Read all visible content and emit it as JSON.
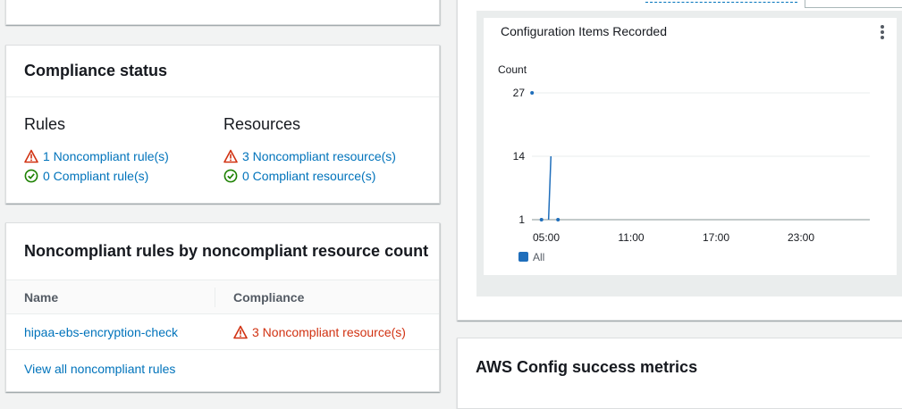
{
  "compliance_status": {
    "title": "Compliance status",
    "rules": {
      "heading": "Rules",
      "noncompliant": "1 Noncompliant rule(s)",
      "compliant": "0 Compliant rule(s)"
    },
    "resources": {
      "heading": "Resources",
      "noncompliant": "3 Noncompliant resource(s)",
      "compliant": "0 Compliant resource(s)"
    }
  },
  "noncompliant_rules": {
    "title": "Noncompliant rules by noncompliant resource count",
    "columns": [
      "Name",
      "Compliance"
    ],
    "rows": [
      {
        "name": "hipaa-ebs-encryption-check",
        "compliance": "3 Noncompliant resource(s)"
      }
    ],
    "view_all": "View all noncompliant rules"
  },
  "config_items_chart": {
    "title": "Configuration Items Recorded",
    "menu_icon": "kebab-menu-icon"
  },
  "success_metrics": {
    "title": "AWS Config success metrics"
  },
  "colors": {
    "link": "#0073bb",
    "error": "#d13212",
    "success": "#1d8102",
    "series": "#1f6ebb"
  },
  "chart_data": {
    "type": "line",
    "title": "Configuration Items Recorded",
    "ylabel": "Count",
    "yticks": [
      1,
      14,
      27
    ],
    "ylim": [
      1,
      27
    ],
    "xticks": [
      "05:00",
      "11:00",
      "17:00",
      "23:00"
    ],
    "legend": "bottom-left",
    "grid": true,
    "series": [
      {
        "name": "All",
        "points": [
          {
            "x": "04:00",
            "y": 27
          },
          {
            "x": "04:40",
            "y": 1
          },
          {
            "x": "05:10",
            "y": 1
          },
          {
            "x": "05:20",
            "y": 14
          },
          {
            "x": "05:50",
            "y": 1
          }
        ]
      }
    ]
  }
}
